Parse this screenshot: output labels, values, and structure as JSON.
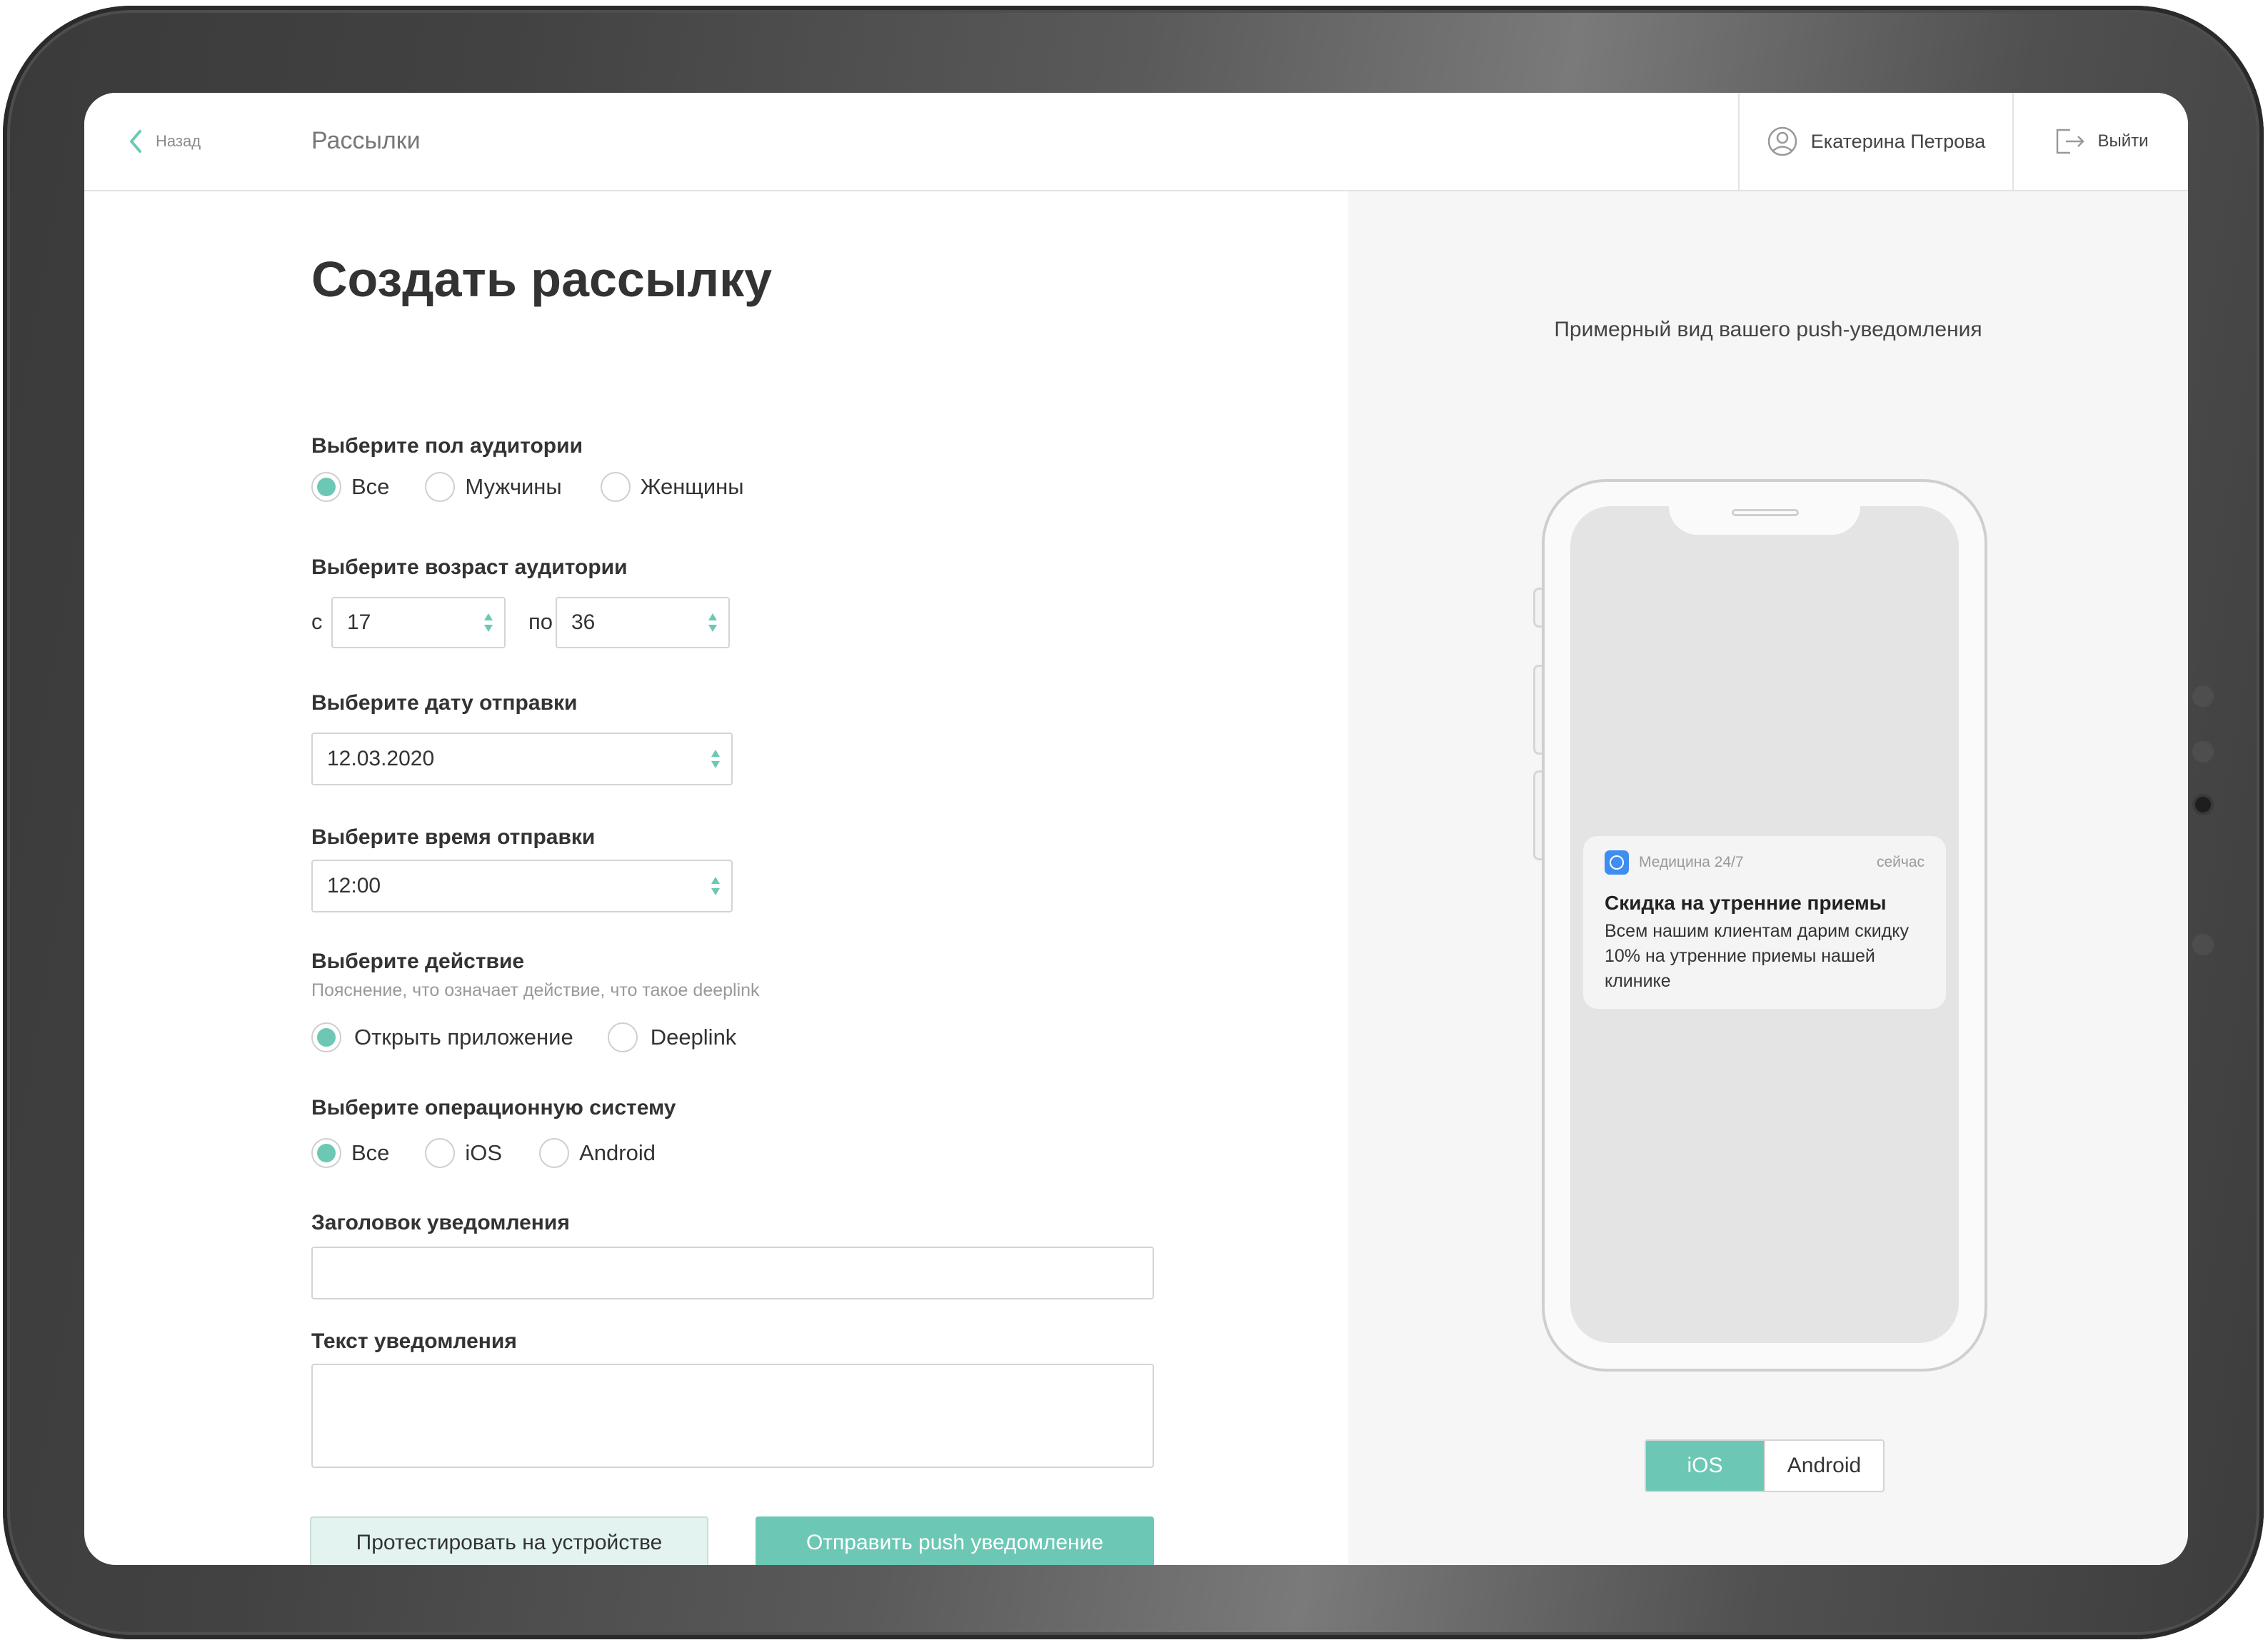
{
  "header": {
    "back_label": "Назад",
    "section_title": "Рассылки",
    "user_name": "Екатерина Петрова",
    "logout_label": "Выйти"
  },
  "form": {
    "title": "Создать рассылку",
    "gender": {
      "label": "Выберите пол аудитории",
      "options": [
        {
          "label": "Все",
          "selected": true
        },
        {
          "label": "Мужчины",
          "selected": false
        },
        {
          "label": "Женщины",
          "selected": false
        }
      ]
    },
    "age": {
      "label": "Выберите возраст аудитории",
      "from_label": "с",
      "from_value": "17",
      "to_label": "по",
      "to_value": "36"
    },
    "date": {
      "label": "Выберите дату отправки",
      "value": "12.03.2020"
    },
    "time": {
      "label": "Выберите время отправки",
      "value": "12:00"
    },
    "action": {
      "label": "Выберите действие",
      "hint": "Пояснение, что означает действие, что такое deeplink",
      "options": [
        {
          "label": "Открыть приложение",
          "selected": true
        },
        {
          "label": "Deeplink",
          "selected": false
        }
      ]
    },
    "os": {
      "label": "Выберите операционную систему",
      "options": [
        {
          "label": "Все",
          "selected": true
        },
        {
          "label": "iOS",
          "selected": false
        },
        {
          "label": "Android",
          "selected": false
        }
      ]
    },
    "notif_title": {
      "label": "Заголовок уведомления",
      "value": ""
    },
    "notif_text": {
      "label": "Текст уведомления",
      "value": ""
    },
    "test_button": "Протестировать на устройстве",
    "send_button": "Отправить push уведомление"
  },
  "preview": {
    "caption": "Примерный вид вашего push-уведомления",
    "notification": {
      "app_name": "Медицина 24/7",
      "time": "сейчас",
      "title": "Скидка на утренние приемы",
      "body": "Всем нашим клиентам дарим скидку 10% на утренние приемы нашей клинике"
    },
    "platform_toggle": [
      {
        "label": "iOS",
        "active": true
      },
      {
        "label": "Android",
        "active": false
      }
    ]
  },
  "colors": {
    "accent": "#6cc8b4",
    "accent_light": "#e3f4f0",
    "app_icon": "#3d8ef0",
    "preview_bg": "#f6f6f6"
  }
}
